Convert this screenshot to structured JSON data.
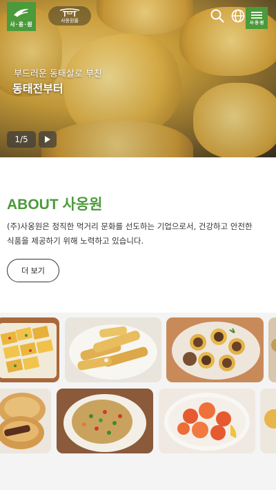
{
  "header": {
    "logo_text": "사·옹·원",
    "brand_pill_text": "사옹원몰",
    "menu_button_text": "사·옹·원",
    "icons": [
      "search-icon",
      "globe-icon",
      "menu-icon"
    ]
  },
  "hero": {
    "subtitle": "부드러운 동태살로 부친",
    "title": "동태전부터",
    "slide_current": 1,
    "slide_total": 5,
    "slide_counter": "1/5"
  },
  "about": {
    "heading": "ABOUT 사옹원",
    "body_line1": "(주)사옹원은 정직한 먹거리 문화를 선도하는 기업으로서, 건강하고 안전한",
    "body_line2": "식품을 제공하기 위해 노력하고 있습니다.",
    "more_label": "더 보기"
  },
  "gallery": {
    "row1": [
      "dish-jeon-squares",
      "dish-fried-fish-sticks",
      "dish-stuffed-mushrooms",
      "dish-partial"
    ],
    "row2": [
      "dish-hotteok",
      "dish-seafood-pancake",
      "dish-shrimp-sauce",
      "dish-partial"
    ]
  },
  "colors": {
    "brand_green": "#4b9a3b",
    "text": "#333333"
  }
}
